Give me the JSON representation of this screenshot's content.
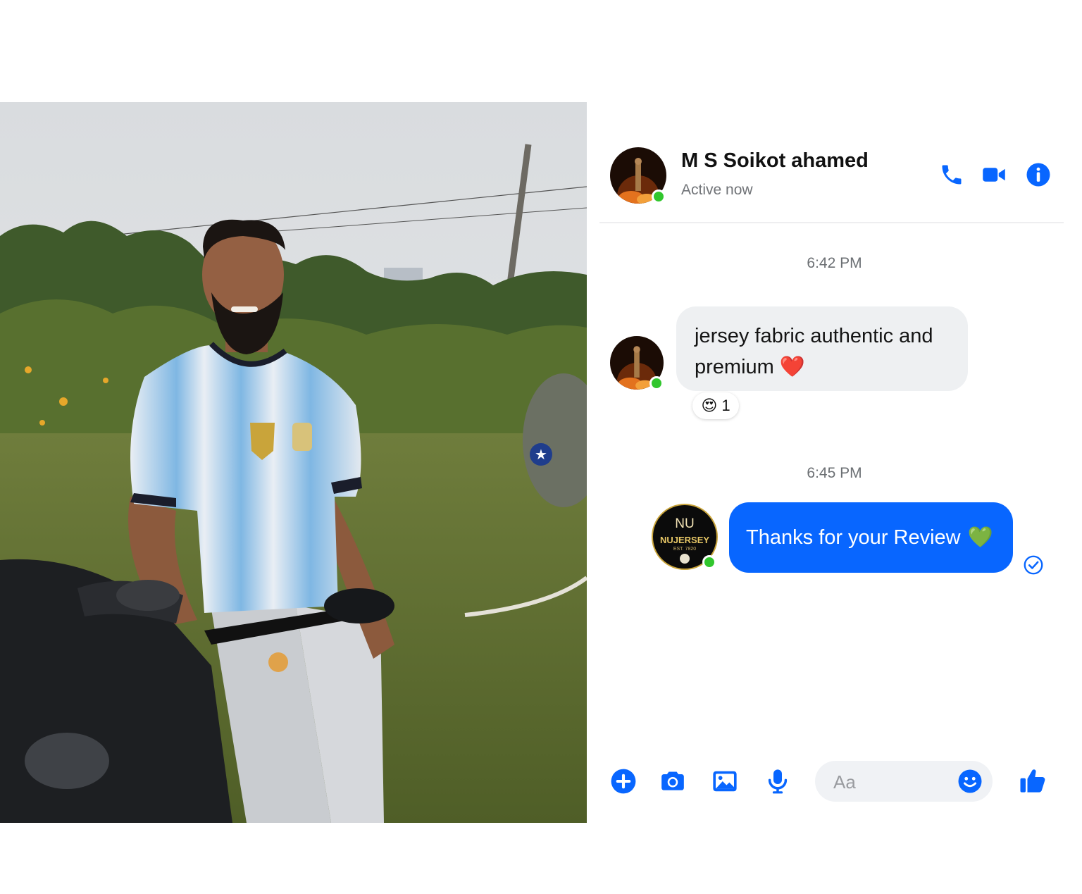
{
  "conversation": {
    "contact_name": "M S Soikot ahamed",
    "status": "Active now"
  },
  "messages": [
    {
      "time": "6:42 PM",
      "text": "jersey fabric authentic and premium",
      "emoji": "❤️",
      "reaction_emoji": "😍",
      "reaction_count": "1"
    },
    {
      "time": "6:45 PM",
      "text": "Thanks for your Review",
      "emoji": "💚"
    }
  ],
  "sender_avatar": {
    "line1": "NU",
    "line2": "NUJERSEY",
    "line3": "EST. 7820"
  },
  "composer": {
    "placeholder": "Aa"
  },
  "icons": [
    "phone-icon",
    "video-camera-icon",
    "info-icon",
    "plus-icon",
    "camera-icon",
    "image-icon",
    "microphone-icon",
    "emoji-icon",
    "thumbs-up-icon",
    "seen-check-icon"
  ],
  "colors": {
    "accent": "#0866ff",
    "online": "#31c62d",
    "incoming_bubble": "#eef0f2"
  }
}
